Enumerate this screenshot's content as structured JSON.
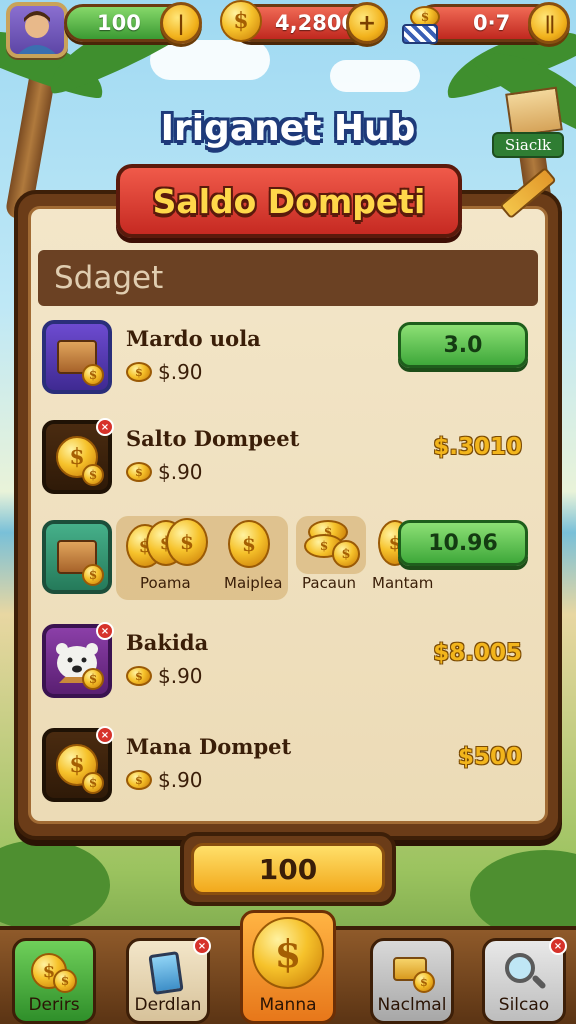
{
  "hud": {
    "lives_value": "100",
    "coins_value": "4,2800",
    "energy_value": "0·7"
  },
  "title": "Iriganet Hub",
  "sign_label": "Siaclk",
  "banner": "Saldo Dompeti",
  "section_header": "Sdaget",
  "items": [
    {
      "name": "Mardo uola",
      "price": "$.90",
      "action": "3.0"
    },
    {
      "name": "Salto Dompeet",
      "price": "$.90",
      "value": "$.3010"
    },
    {
      "coin_labels": [
        "Poama",
        "Maiplea",
        "Pacaun",
        "Mantam"
      ],
      "action": "10.96"
    },
    {
      "name": "Bakida",
      "price": "$.90",
      "value": "$8.005"
    },
    {
      "name": "Mana Dompet",
      "price": "$.90",
      "value": "$500"
    }
  ],
  "bottom_value": "100",
  "nav": [
    {
      "label": "Derirs"
    },
    {
      "label": "Derdlan"
    },
    {
      "label": "Manna"
    },
    {
      "label": "Naclmal"
    },
    {
      "label": "Silcao"
    }
  ],
  "colors": {
    "banner_red": "#c62a22",
    "gold": "#f2b51c",
    "green_button": "#3ea83a",
    "board_brown": "#6b3c18"
  }
}
